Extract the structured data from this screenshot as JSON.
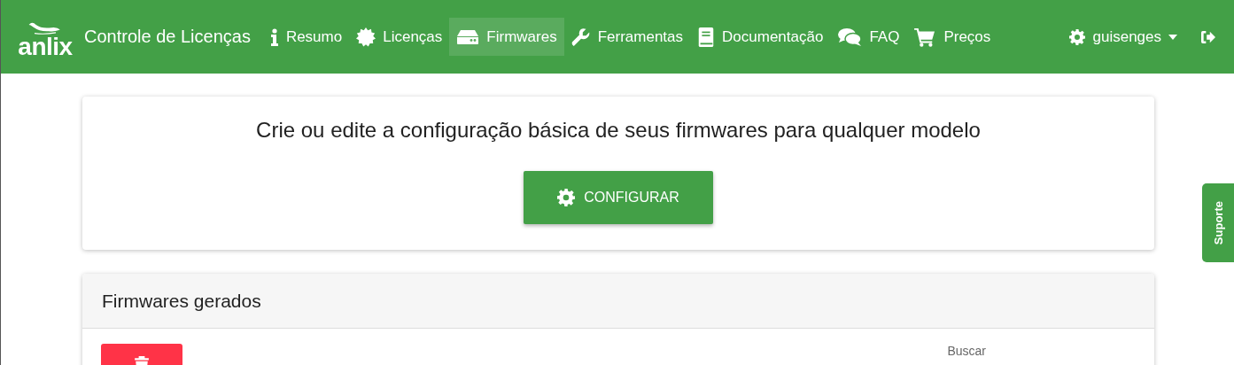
{
  "navbar": {
    "brand": "anlix",
    "title": "Controle de Licenças",
    "items": [
      {
        "label": "Resumo",
        "selected": false
      },
      {
        "label": "Licenças",
        "selected": false
      },
      {
        "label": "Firmwares",
        "selected": true
      },
      {
        "label": "Ferramentas",
        "selected": false
      },
      {
        "label": "Documentação",
        "selected": false
      },
      {
        "label": "FAQ",
        "selected": false
      },
      {
        "label": "Preços",
        "selected": false
      }
    ],
    "user": "guisenges"
  },
  "config_card": {
    "heading": "Crie ou edite a configuração básica de seus firmwares para qualquer modelo",
    "button": "CONFIGURAR"
  },
  "firmwares_card": {
    "title": "Firmwares gerados",
    "search_label": "Buscar"
  },
  "support_tab": "Suporte"
}
